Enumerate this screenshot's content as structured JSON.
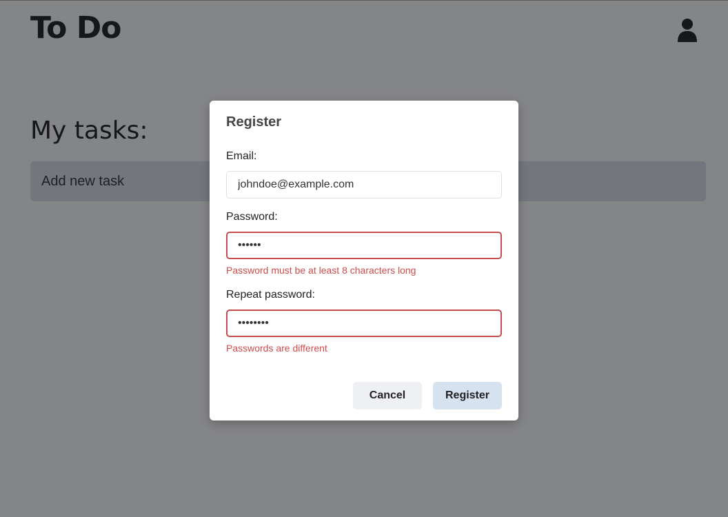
{
  "header": {
    "app_title": "To Do",
    "user_icon": "user-icon"
  },
  "main": {
    "section_title": "My tasks:",
    "add_task_placeholder": "Add new task"
  },
  "dialog": {
    "title": "Register",
    "email": {
      "label": "Email:",
      "value": "johndoe@example.com"
    },
    "password": {
      "label": "Password:",
      "value": "123456",
      "error": "Password must be at least 8 characters long"
    },
    "repeat_password": {
      "label": "Repeat password:",
      "value": "12345678",
      "error": "Passwords are different"
    },
    "cancel_label": "Cancel",
    "register_label": "Register"
  },
  "colors": {
    "error": "#d14b4b",
    "primary_button": "#d6e2ef",
    "secondary_button": "#eef0f3"
  }
}
